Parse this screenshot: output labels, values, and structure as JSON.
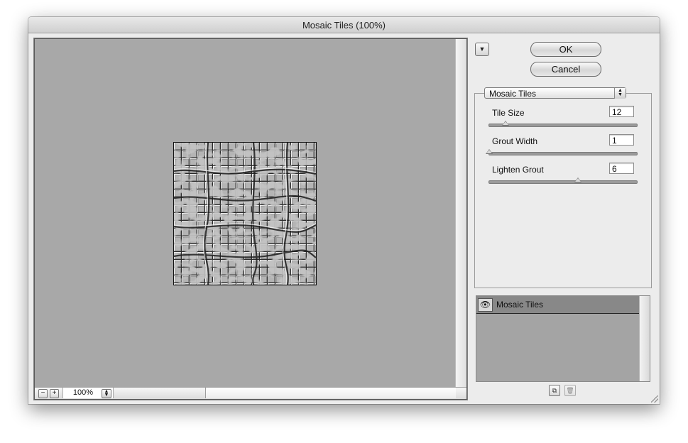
{
  "window": {
    "title": "Mosaic Tiles (100%)"
  },
  "preview": {
    "zoom_out_symbol": "−",
    "zoom_in_symbol": "+",
    "zoom_level": "100%"
  },
  "buttons": {
    "ok": "OK",
    "cancel": "Cancel"
  },
  "filter_select": {
    "selected": "Mosaic Tiles"
  },
  "parameters": [
    {
      "label": "Tile Size",
      "value": "12",
      "fraction": 0.11
    },
    {
      "label": "Grout Width",
      "value": "1",
      "fraction": 0.0
    },
    {
      "label": "Lighten Grout",
      "value": "6",
      "fraction": 0.6
    }
  ],
  "layers": [
    {
      "name": "Mosaic Tiles",
      "visible": true
    }
  ],
  "icons": {
    "menu_toggle": "triangle-down-icon",
    "eye": "eye-icon",
    "new_layer": "new-effect-layer-icon",
    "delete": "trash-icon"
  },
  "colors": {
    "preview_bg": "#a8a8a8",
    "window_bg": "#ececec",
    "layer_row": "#888888"
  }
}
